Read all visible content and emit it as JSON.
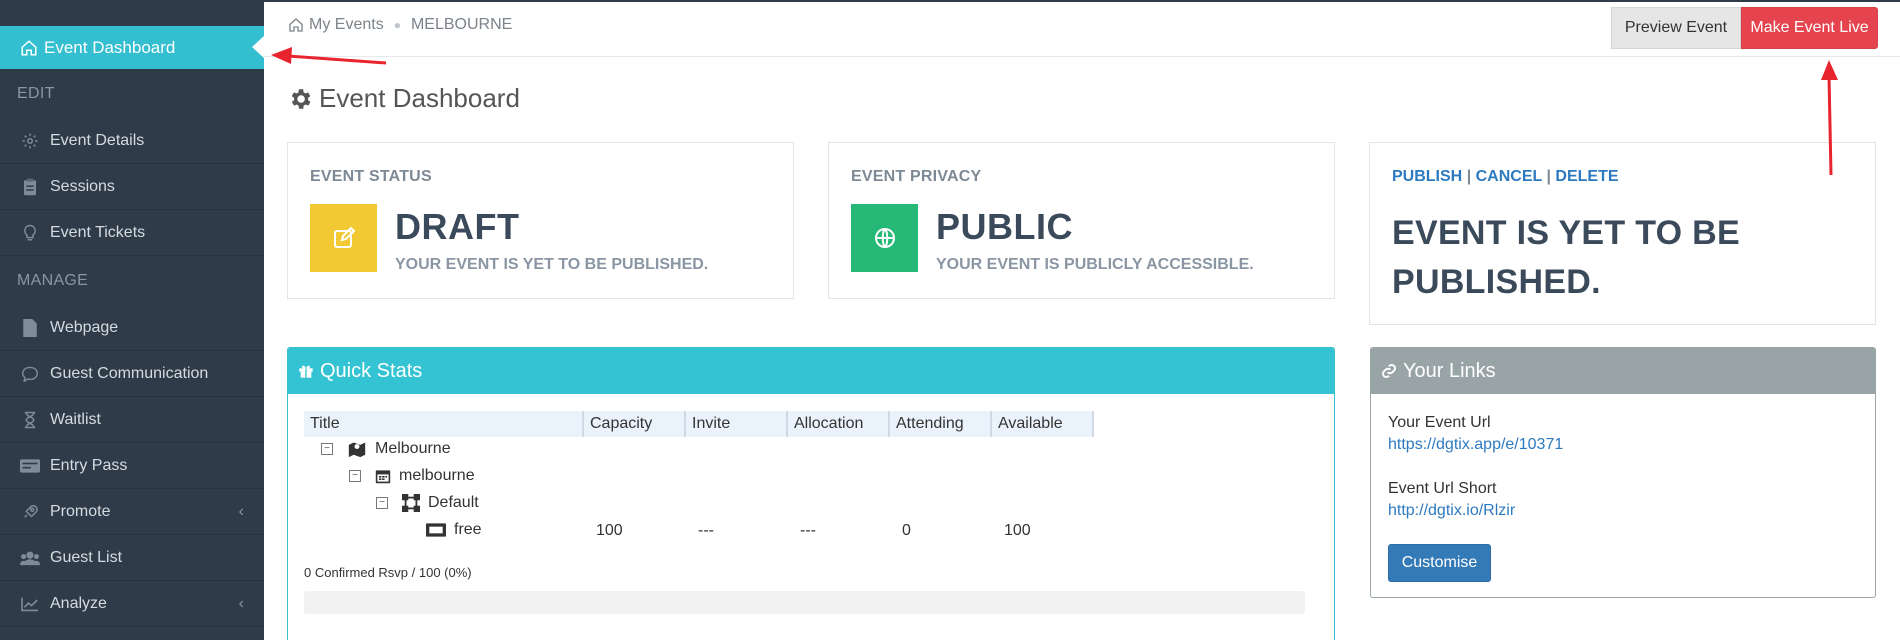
{
  "sidebar": {
    "active": "Event Dashboard",
    "edit_section": "EDIT",
    "manage_section": "MANAGE",
    "items": [
      {
        "label": "Event Details",
        "icon": "gear-icon"
      },
      {
        "label": "Sessions",
        "icon": "clipboard-icon"
      },
      {
        "label": "Event Tickets",
        "icon": "lightbulb-icon"
      },
      {
        "label": "Webpage",
        "icon": "file-icon"
      },
      {
        "label": "Guest Communication",
        "icon": "chat-icon"
      },
      {
        "label": "Waitlist",
        "icon": "hourglass-icon"
      },
      {
        "label": "Entry Pass",
        "icon": "card-icon"
      },
      {
        "label": "Promote",
        "icon": "rocket-icon"
      },
      {
        "label": "Guest List",
        "icon": "users-icon"
      },
      {
        "label": "Analyze",
        "icon": "chart-icon"
      }
    ]
  },
  "topbar": {
    "crumb_home": "My Events",
    "crumb_current": "MELBOURNE",
    "preview": "Preview Event",
    "live": "Make Event Live"
  },
  "page": {
    "title": "Event Dashboard"
  },
  "status": {
    "label": "EVENT STATUS",
    "value": "DRAFT",
    "sub": "YOUR EVENT IS YET TO BE PUBLISHED.",
    "color": "#f2c933"
  },
  "privacy": {
    "label": "EVENT PRIVACY",
    "value": "PUBLIC",
    "sub": "YOUR EVENT IS PUBLICLY ACCESSIBLE.",
    "color": "#26b876"
  },
  "actions": {
    "publish": "PUBLISH",
    "sep": "|",
    "cancel": "CANCEL",
    "delete": "DELETE",
    "message": "EVENT IS YET TO BE PUBLISHED."
  },
  "quick_stats": {
    "title": "Quick Stats",
    "columns": [
      "Title",
      "Capacity",
      "Invite",
      "Allocation",
      "Attending",
      "Available"
    ],
    "tree": [
      {
        "label": "Melbourne",
        "toggle": "⊟"
      },
      {
        "label": "melbourne",
        "toggle": "⊟"
      },
      {
        "label": "Default",
        "toggle": "⊟"
      },
      {
        "label": "free"
      }
    ],
    "row": {
      "capacity": "100",
      "invite": "---",
      "allocation": "---",
      "attending": "0",
      "available": "100"
    },
    "rsvp": "0 Confirmed Rsvp / 100 (0%)",
    "progress": 0
  },
  "links": {
    "title": "Your Links",
    "url_label": "Your Event Url",
    "url": "https://dgtix.app/e/10371",
    "short_label": "Event Url Short",
    "short": "http://dgtix.io/Rlzir",
    "customise": "Customise"
  }
}
